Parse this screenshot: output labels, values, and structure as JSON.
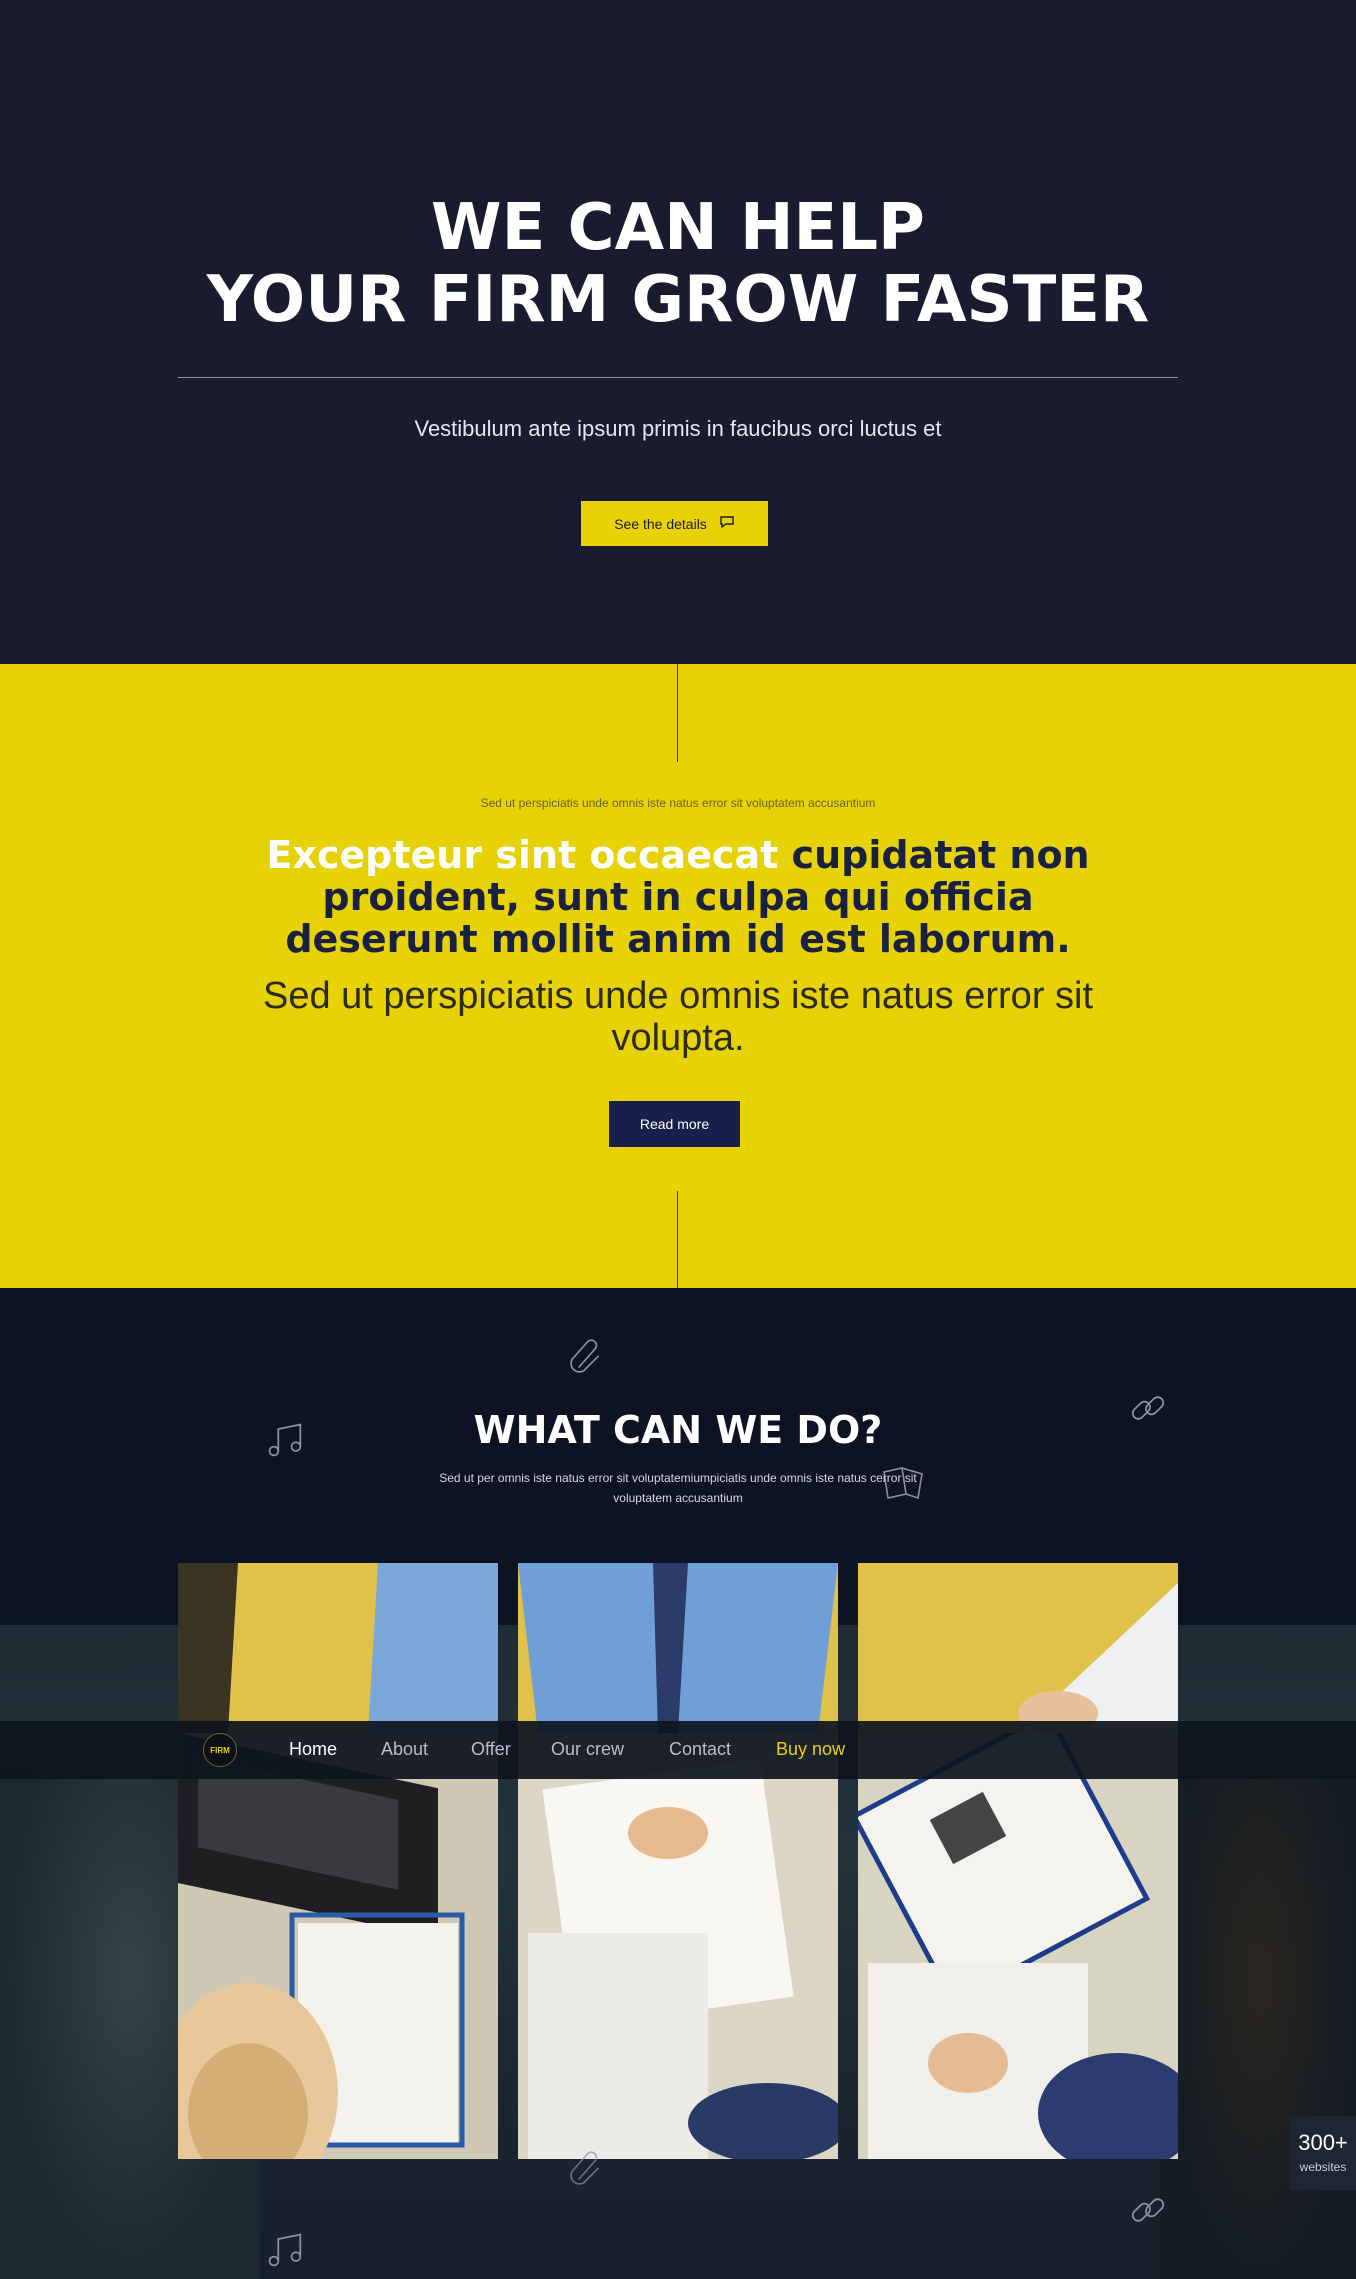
{
  "hero": {
    "title_line1": "WE CAN HELP",
    "title_line2": "YOUR FIRM GROW FASTER",
    "subtitle": "Vestibulum ante ipsum primis in faucibus orci luctus et",
    "button_label": "See the details",
    "button_icon": "chat-bubble-icon"
  },
  "yellow_section": {
    "kicker": "Sed ut perspiciatis unde omnis iste natus error sit voluptatem accusantium",
    "heading_white": "Excepteur sint occaecat",
    "heading_dark": " cupidatat non proident, sunt in culpa qui officia deserunt mollit anim id est laborum.",
    "light_text": "Sed ut perspiciatis unde omnis iste natus error sit volupta.",
    "button_label": "Read more"
  },
  "services": {
    "title": "WHAT CAN WE DO?",
    "subtitle": "Sed ut per omnis iste natus error sit voluptatemiumpiciatis unde omnis iste natus cerror sit voluptatem accusantium",
    "icons": [
      "paperclip-icon",
      "music-icon",
      "link-icon",
      "book-icon"
    ]
  },
  "nav": {
    "logo_text": "FIRM",
    "items": [
      "Home",
      "About",
      "Offer",
      "Our crew",
      "Contact",
      "Buy now"
    ]
  },
  "badge": {
    "count": "300+",
    "label": "websites"
  },
  "colors": {
    "navy": "#181c2e",
    "yellow": "#e6d205",
    "button_navy": "#17204a"
  }
}
